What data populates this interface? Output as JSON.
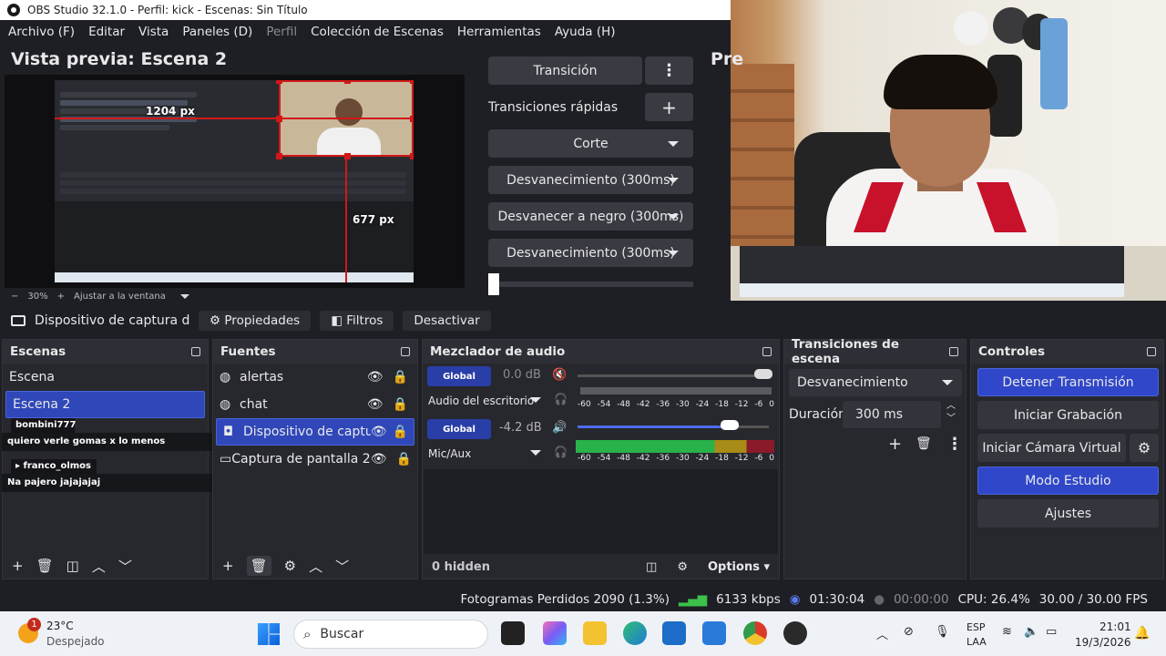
{
  "window": {
    "title": "OBS Studio 32.1.0 - Perfil: kick - Escenas: Sin Título"
  },
  "menu": [
    "Archivo (F)",
    "Editar",
    "Vista",
    "Paneles (D)",
    "Perfil",
    "Colección de Escenas",
    "Herramientas",
    "Ayuda (H)"
  ],
  "preview": {
    "title": "Vista previa: Escena 2",
    "program_title_partial": "Pre",
    "width_label": "1204 px",
    "height_label": "677 px",
    "zoom": "30%",
    "fit": "Ajustar a la ventana",
    "minus": "−",
    "plus": "+"
  },
  "transitions_panel": {
    "transition_button": "Transición",
    "quick_transitions": "Transiciones rápidas",
    "items": [
      "Corte",
      "Desvanecimiento (300ms)",
      "Desvanecer a negro (300ms)",
      "Desvanecimiento (300ms)"
    ]
  },
  "source_toolbar": {
    "selected": "Dispositivo de captura de v",
    "properties": "Propiedades",
    "filters": "Filtros",
    "deactivate": "Desactivar"
  },
  "scenes": {
    "header": "Escenas",
    "items": [
      "Escena",
      "Escena 2"
    ]
  },
  "chat": [
    {
      "user": "bombini777",
      "message": "quiero verle gomas x lo menos"
    },
    {
      "user": "franco_olmos",
      "message": "Na pajero jajajajaj"
    }
  ],
  "sources": {
    "header": "Fuentes",
    "items": [
      "alertas",
      "chat",
      "Dispositivo de captura",
      "Captura de pantalla 2"
    ]
  },
  "mixer": {
    "header": "Mezclador de audio",
    "channels": [
      {
        "badge": "Global",
        "db": "0.0 dB",
        "name": "Audio del escritorio",
        "muted": true,
        "level": 1.0
      },
      {
        "badge": "Global",
        "db": "-4.2 dB",
        "name": "Mic/Aux",
        "muted": false,
        "level": 0.85
      }
    ],
    "scale": [
      "-60",
      "-54",
      "-48",
      "-42",
      "-36",
      "-30",
      "-24",
      "-18",
      "-12",
      "-6",
      "0"
    ],
    "hidden": "0 hidden",
    "options": "Options"
  },
  "scene_transitions": {
    "header": "Transiciones de escena",
    "selected": "Desvanecimiento",
    "duration_label": "Duración",
    "duration_value": "300 ms"
  },
  "controls": {
    "header": "Controles",
    "stop_stream": "Detener Transmisión",
    "start_recording": "Iniciar Grabación",
    "virtual_cam": "Iniciar Cámara Virtual",
    "studio_mode": "Modo Estudio",
    "settings": "Ajustes"
  },
  "status": {
    "dropped": "Fotogramas Perdidos 2090 (1.3%)",
    "bitrate": "6133 kbps",
    "stream_time": "01:30:04",
    "rec_time": "00:00:00",
    "cpu": "CPU: 26.4%",
    "fps": "30.00 / 30.00 FPS"
  },
  "taskbar": {
    "temp": "23°C",
    "weather": "Despejado",
    "weather_badge": "1",
    "search": "Buscar",
    "lang1": "ESP",
    "lang2": "LAA",
    "time": "21:01",
    "date": "19/3/2026"
  },
  "colors": {
    "accent": "#2f47c8",
    "panel": "#27282e",
    "bg": "#1e1f24",
    "selection": "#d01818"
  }
}
